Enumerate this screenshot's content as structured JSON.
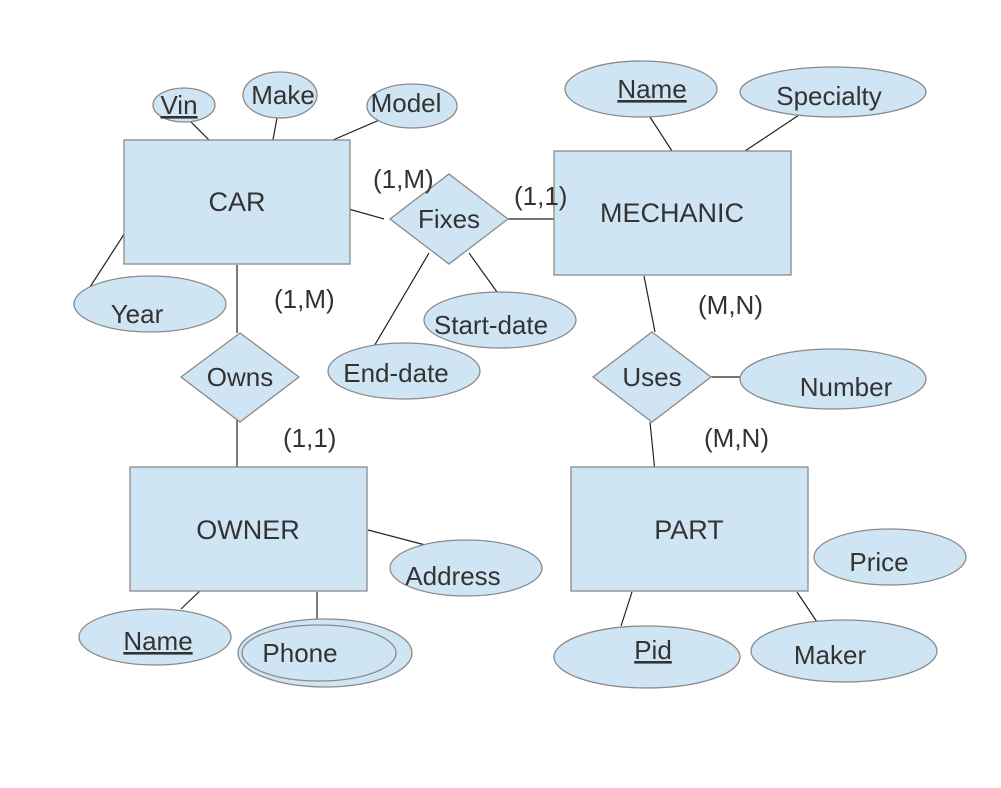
{
  "diagram": {
    "type": "ER diagram",
    "entities": [
      {
        "id": "car",
        "label": "CAR"
      },
      {
        "id": "mechanic",
        "label": "MECHANIC"
      },
      {
        "id": "owner",
        "label": "OWNER"
      },
      {
        "id": "part",
        "label": "PART"
      }
    ],
    "relationships": [
      {
        "id": "fixes",
        "label": "Fixes"
      },
      {
        "id": "owns",
        "label": "Owns"
      },
      {
        "id": "uses",
        "label": "Uses"
      }
    ],
    "attributes": {
      "car_vin": {
        "label": "Vin",
        "key": true
      },
      "car_make": {
        "label": "Make"
      },
      "car_model": {
        "label": "Model"
      },
      "car_year": {
        "label": "Year"
      },
      "mech_name": {
        "label": "Name",
        "key": true
      },
      "mech_specialty": {
        "label": "Specialty"
      },
      "fixes_start": {
        "label": "Start-date"
      },
      "fixes_end": {
        "label": "End-date"
      },
      "uses_number": {
        "label": "Number"
      },
      "owner_address": {
        "label": "Address"
      },
      "owner_name": {
        "label": "Name",
        "key": true
      },
      "owner_phone": {
        "label": "Phone",
        "multivalued": true
      },
      "part_price": {
        "label": "Price"
      },
      "part_pid": {
        "label": "Pid",
        "key": true
      },
      "part_maker": {
        "label": "Maker"
      }
    },
    "cardinalities": {
      "car_fixes": "(1,M)",
      "fixes_mechanic": "(1,1)",
      "car_owns": "(1,M)",
      "owns_owner": "(1,1)",
      "mechanic_uses": "(M,N)",
      "uses_part": "(M,N)"
    },
    "colors": {
      "fill": "#cfe5f4",
      "stroke": "#8a8a8a",
      "text": "#333333",
      "edge": "#222222"
    }
  }
}
